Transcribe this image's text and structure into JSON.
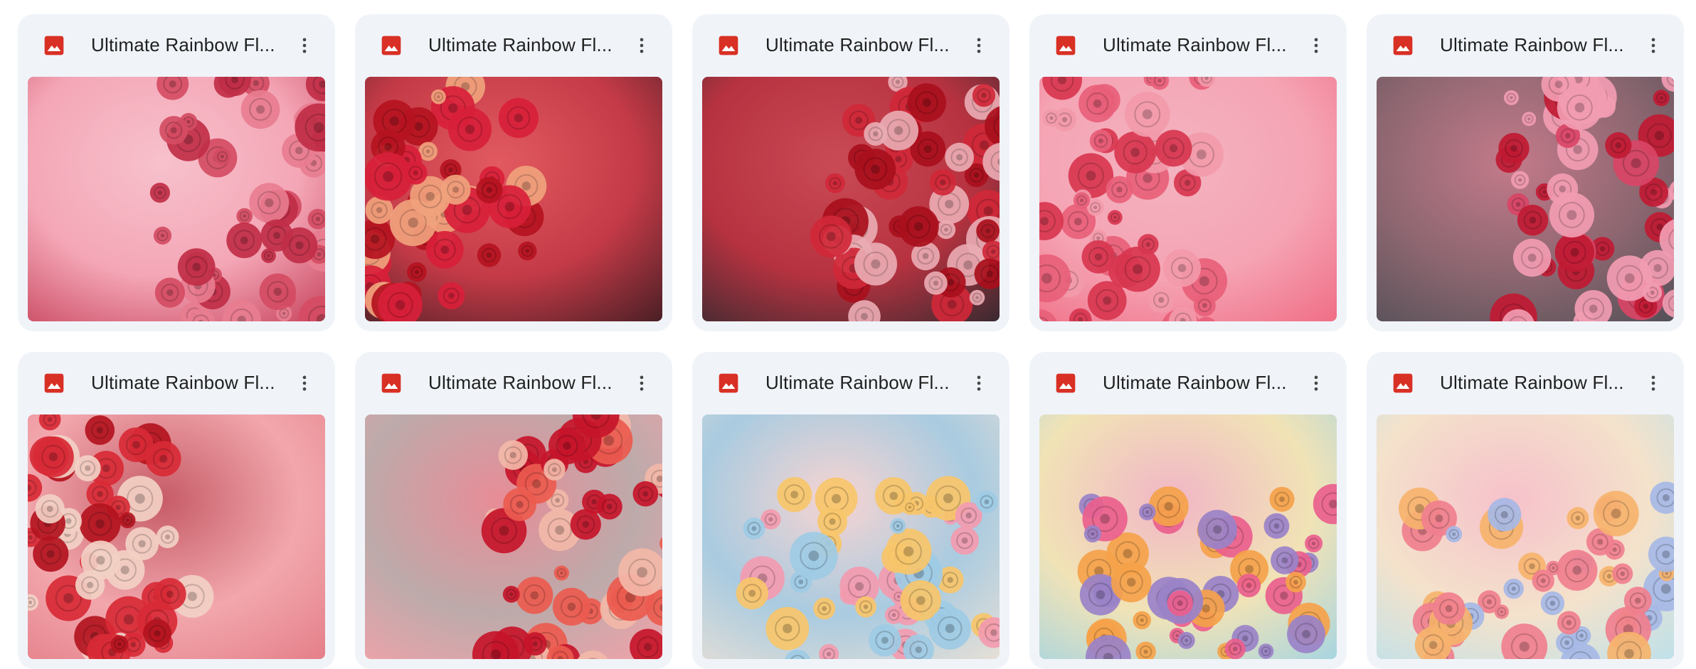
{
  "files": [
    {
      "title": "Ultimate Rainbow Fl...",
      "preview": "red-pink floral wall",
      "bg": [
        "#c8455e",
        "#f4a6b6",
        "#f7c1cc"
      ],
      "flowers": [
        "#d44c63",
        "#e87d90",
        "#c02e47"
      ]
    },
    {
      "title": "Ultimate Rainbow Fl...",
      "preview": "deep red roses",
      "bg": [
        "#4a1f25",
        "#c43a47",
        "#e25a60"
      ],
      "flowers": [
        "#b5121f",
        "#d8203a",
        "#f0a27d"
      ]
    },
    {
      "title": "Ultimate Rainbow Fl...",
      "preview": "dark red roses",
      "bg": [
        "#3a2a30",
        "#b73240",
        "#c94a55"
      ],
      "flowers": [
        "#a90f1c",
        "#d02838",
        "#e9aab2"
      ]
    },
    {
      "title": "Ultimate Rainbow Fl...",
      "preview": "pink roses on pink wall",
      "bg": [
        "#f06e86",
        "#f5a4b4",
        "#f3b3c0"
      ],
      "flowers": [
        "#e8607a",
        "#f29aaa",
        "#d8364f"
      ]
    },
    {
      "title": "Ultimate Rainbow Fl...",
      "preview": "pink roses on grey wall",
      "bg": [
        "#545057",
        "#8c6670",
        "#c47a8a"
      ],
      "flowers": [
        "#c01a33",
        "#f29cb2",
        "#d94466"
      ]
    },
    {
      "title": "Ultimate Rainbow Fl...",
      "preview": "red roses on pink",
      "bg": [
        "#e57f89",
        "#f2a7ad",
        "#c65b66"
      ],
      "flowers": [
        "#b3141e",
        "#f2d0c4",
        "#d82a36"
      ]
    },
    {
      "title": "Ultimate Rainbow Fl...",
      "preview": "red dahlias",
      "bg": [
        "#f2a2a9",
        "#bdaaaa",
        "#e88c97"
      ],
      "flowers": [
        "#c6152a",
        "#ec5b4f",
        "#f2b8a8"
      ]
    },
    {
      "title": "Ultimate Rainbow Fl...",
      "preview": "pastel rainbow flowers",
      "bg": [
        "#e6dfd6",
        "#a9cbe0",
        "#f7d4d2"
      ],
      "flowers": [
        "#f39bb0",
        "#f7c66a",
        "#9ecbe5"
      ]
    },
    {
      "title": "Ultimate Rainbow Fl...",
      "preview": "rainbow roses",
      "bg": [
        "#a8d5e0",
        "#f1e3b6",
        "#f1b6c6"
      ],
      "flowers": [
        "#ea5f8d",
        "#f5a24a",
        "#9a82c8"
      ]
    },
    {
      "title": "Ultimate Rainbow Fl...",
      "preview": "pastel floral corner",
      "bg": [
        "#bfe1ea",
        "#f4e2cb",
        "#f6c1cb"
      ],
      "flowers": [
        "#f07f8e",
        "#f6b36d",
        "#a6b8e6"
      ]
    }
  ],
  "icons": {
    "file_type": "image-file-icon",
    "file_icon_color": "#d93025",
    "more": "more-vert-icon"
  }
}
